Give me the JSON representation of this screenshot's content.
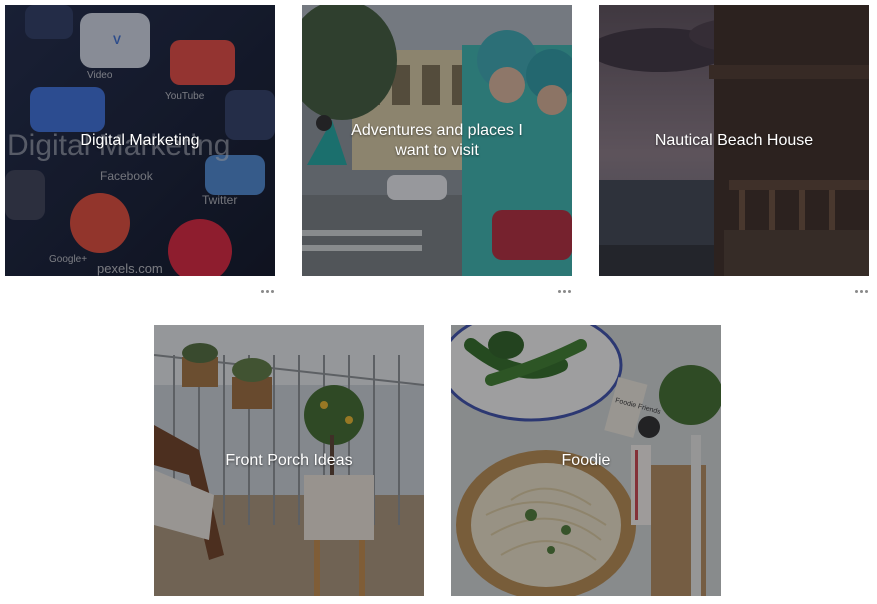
{
  "boards": [
    {
      "title": "Digital Marketing",
      "image_caption": "Digital Marketing",
      "watermark": "pexels.com",
      "app_labels": [
        "Video",
        "YouTube",
        "Facebook",
        "Twitter",
        "Google+"
      ]
    },
    {
      "title": "Adventures and places I want to visit"
    },
    {
      "title": "Nautical Beach House"
    },
    {
      "title": "Front Porch Ideas"
    },
    {
      "title": "Foodie",
      "package_label": "Foodie Friends"
    }
  ],
  "more_options_icon": "ellipsis-icon"
}
